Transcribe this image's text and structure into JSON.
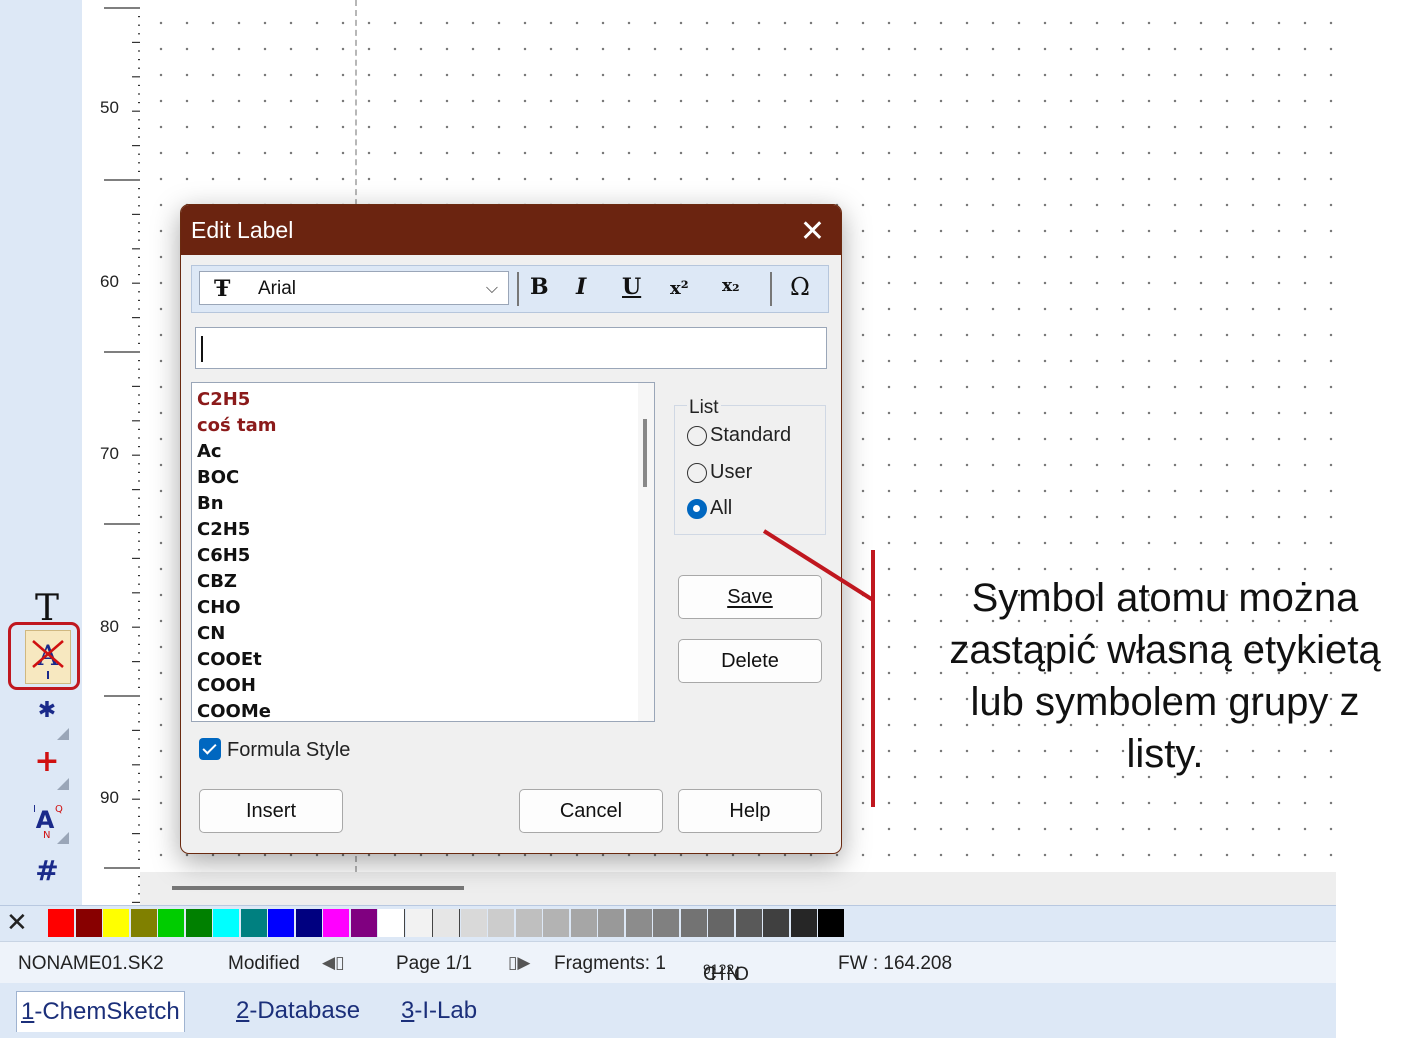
{
  "ruler": {
    "marks": [
      "50",
      "60",
      "70",
      "80",
      "90"
    ]
  },
  "left_toolbar": {
    "tools": [
      {
        "name": "text",
        "glyph": "T"
      },
      {
        "name": "edit-label",
        "glyph": "A"
      },
      {
        "name": "asterisk",
        "glyph": "✱"
      },
      {
        "name": "plus",
        "glyph": "+"
      },
      {
        "name": "atom-properties",
        "glyph": "A"
      },
      {
        "name": "hash",
        "glyph": "#"
      }
    ]
  },
  "dialog": {
    "title": "Edit Label",
    "close_glyph": "✕",
    "font_name": "Arial",
    "format_buttons": {
      "bold": "B",
      "italic": "I",
      "underline": "U",
      "superscript": "x²",
      "subscript": "x₂",
      "symbol": "Ω"
    },
    "input_value": "",
    "list_items": [
      {
        "text": "C2H5",
        "user": true
      },
      {
        "text": "coś tam",
        "user": true
      },
      {
        "text": "Ac",
        "user": false
      },
      {
        "text": "BOC",
        "user": false
      },
      {
        "text": "Bn",
        "user": false
      },
      {
        "text": "C2H5",
        "user": false
      },
      {
        "text": "C6H5",
        "user": false
      },
      {
        "text": "CBZ",
        "user": false
      },
      {
        "text": "CHO",
        "user": false
      },
      {
        "text": "CN",
        "user": false
      },
      {
        "text": "COOEt",
        "user": false
      },
      {
        "text": "COOH",
        "user": false
      },
      {
        "text": "COOMe",
        "user": false
      }
    ],
    "list_group_label": "List",
    "radio_options": [
      {
        "label": "Standard",
        "checked": false
      },
      {
        "label": "User",
        "checked": false
      },
      {
        "label": "All",
        "checked": true
      }
    ],
    "buttons": {
      "save": "Save",
      "delete": "Delete",
      "insert": "Insert",
      "cancel": "Cancel",
      "help": "Help"
    },
    "formula_style": {
      "label": "Formula Style",
      "checked": true
    }
  },
  "palette": {
    "colors": [
      "#ff0000",
      "#880000",
      "#ffff00",
      "#808000",
      "#00cc00",
      "#008000",
      "#00ffff",
      "#008080",
      "#0000ff",
      "#000080",
      "#ff00ff",
      "#800080",
      "#ffffff",
      "#f2f2f2",
      "#e6e6e6",
      "#d9d9d9",
      "#cccccc",
      "#bfbfbf",
      "#b3b3b3",
      "#a6a6a6",
      "#999999",
      "#8c8c8c",
      "#808080",
      "#737373",
      "#666666",
      "#595959",
      "#404040",
      "#262626",
      "#000000"
    ]
  },
  "statusbar": {
    "filename": "NONAME01.SK2",
    "modified": "Modified",
    "page": "Page 1/1",
    "fragments": "Fragments: 1",
    "formula_parts": [
      "C",
      "9",
      "H",
      "12",
      "N",
      "2",
      "O"
    ],
    "fw": "FW : 164.208"
  },
  "tabs": [
    {
      "num": "1",
      "label": "-ChemSketch"
    },
    {
      "num": "2",
      "label": "-Database"
    },
    {
      "num": "3",
      "label": "-I-Lab"
    }
  ],
  "annotation": {
    "lines": [
      "Symbol atomu można",
      "zastąpić własną etykietą",
      "lub symbolem grupy z",
      "listy."
    ],
    "color": "#c0171f"
  }
}
